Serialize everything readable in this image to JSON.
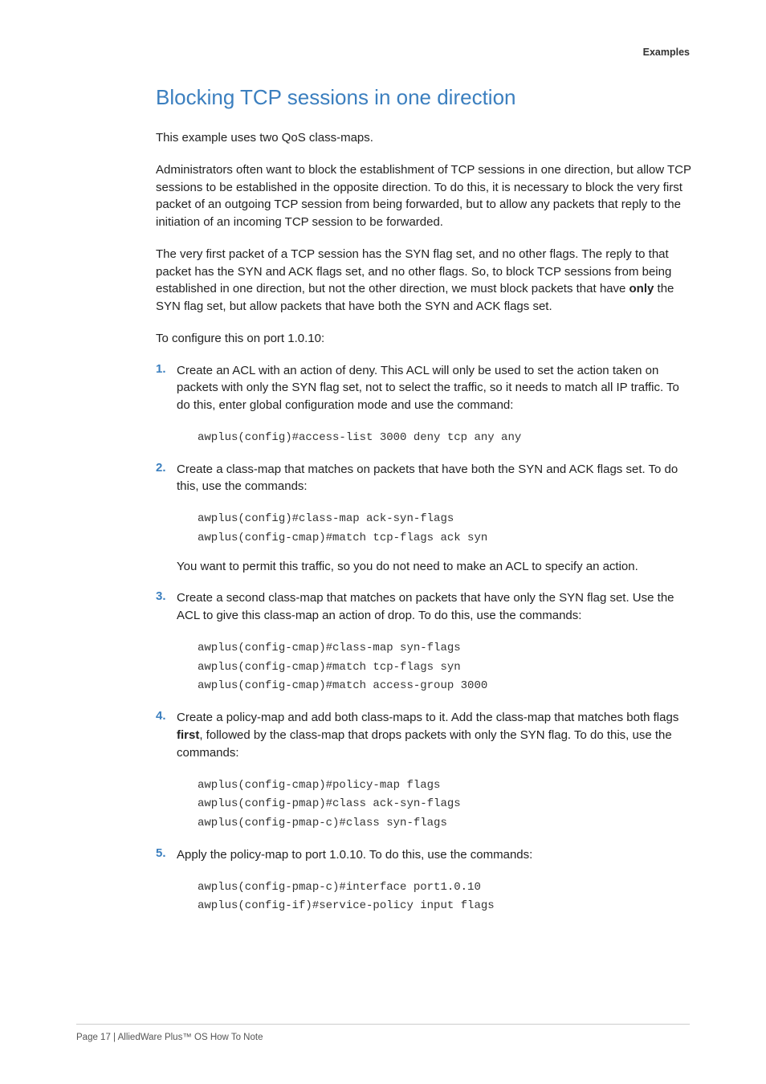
{
  "header": {
    "caption": "Examples"
  },
  "title": "Blocking TCP sessions in one direction",
  "intro1": "This example uses two QoS class-maps.",
  "intro2": "Administrators often want to block the establishment of TCP sessions in one direction, but allow TCP sessions to be established in the opposite direction. To do this, it is necessary to block the very first packet of an outgoing TCP session from being forwarded, but to allow any packets that reply to the initiation of an incoming TCP session to be forwarded.",
  "intro3a": "The very first packet of a TCP session has the SYN flag set, and no other flags.  The reply to that packet has the SYN and ACK flags set, and no other flags. So, to block TCP sessions from being established in one direction, but not the other direction, we must block packets that have ",
  "intro3_bold": "only",
  "intro3b": " the SYN flag set, but allow packets that have both the SYN and ACK flags set.",
  "intro4": "To configure this on port 1.0.10:",
  "steps": {
    "s1": {
      "num": "1.",
      "text": "Create an ACL with an action of deny. This ACL will only be used to set the action taken on packets with only the SYN flag set, not to select the traffic, so it needs to match all IP traffic. To do this, enter global configuration mode and use the command:",
      "code": [
        "awplus(config)#access-list 3000 deny tcp any any"
      ]
    },
    "s2": {
      "num": "2.",
      "text": "Create a class-map that matches on packets that have both the SYN and ACK flags set. To do this, use the commands:",
      "code": [
        "awplus(config)#class-map ack-syn-flags",
        "awplus(config-cmap)#match tcp-flags ack syn"
      ],
      "after": "You want to permit this traffic, so you do not need to make an ACL to specify an action."
    },
    "s3": {
      "num": "3.",
      "text": "Create a second class-map that matches on packets that have only the SYN flag set. Use the ACL to give this class-map an action of drop. To do this, use the commands:",
      "code": [
        "awplus(config-cmap)#class-map syn-flags",
        "awplus(config-cmap)#match tcp-flags syn",
        "awplus(config-cmap)#match access-group 3000"
      ]
    },
    "s4": {
      "num": "4.",
      "text_a": "Create a policy-map and add both class-maps to it. Add the class-map that matches both flags ",
      "text_bold": "first",
      "text_b": ", followed by the class-map that drops packets with only the SYN flag. To do this, use the commands:",
      "code": [
        "awplus(config-cmap)#policy-map flags",
        "awplus(config-pmap)#class ack-syn-flags",
        "awplus(config-pmap-c)#class syn-flags"
      ]
    },
    "s5": {
      "num": "5.",
      "text": "Apply the policy-map to port 1.0.10. To do this, use the commands:",
      "code": [
        "awplus(config-pmap-c)#interface port1.0.10",
        "awplus(config-if)#service-policy input flags"
      ]
    }
  },
  "footer": "Page 17 | AlliedWare Plus™ OS How To Note"
}
